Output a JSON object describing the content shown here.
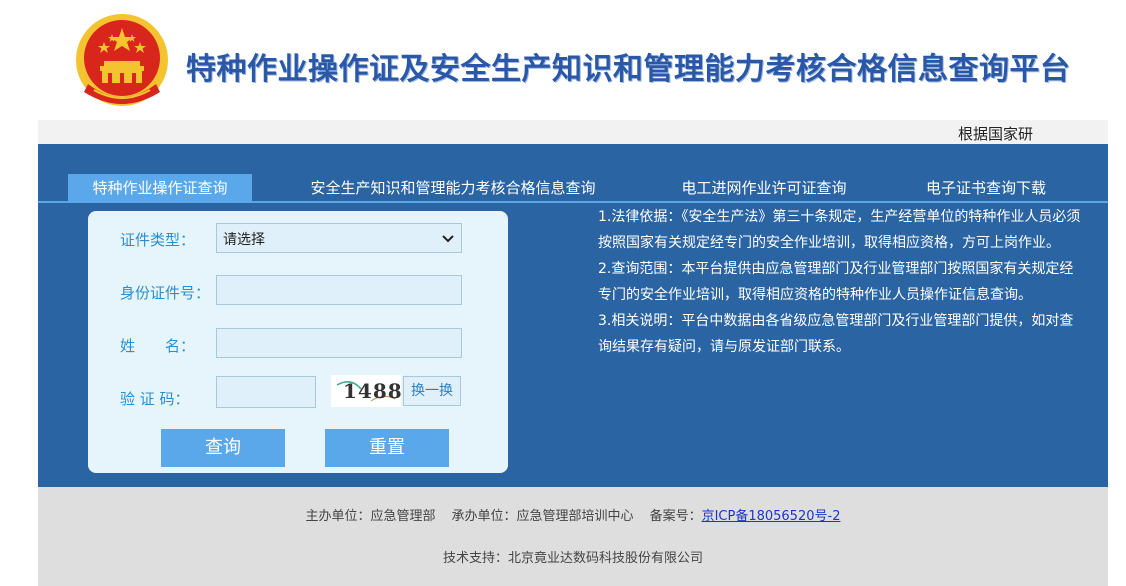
{
  "header": {
    "title": "特种作业操作证及安全生产知识和管理能力考核合格信息查询平台"
  },
  "marquee": {
    "text": "根据国家研"
  },
  "tabs": [
    {
      "label": "特种作业操作证查询",
      "active": true
    },
    {
      "label": "安全生产知识和管理能力考核合格信息查询",
      "active": false
    },
    {
      "label": "电工进网作业许可证查询",
      "active": false
    },
    {
      "label": "电子证书查询下载",
      "active": false
    }
  ],
  "form": {
    "cert_type_label": "证件类型：",
    "cert_type_value": "请选择",
    "id_number_label": "身份证件号：",
    "id_number_value": "",
    "name_label": "姓　　名：",
    "name_value": "",
    "captcha_label": "验 证 码：",
    "captcha_value": "",
    "captcha_image_text": "1488",
    "refresh_label": "换一换",
    "query_label": "查询",
    "reset_label": "重置"
  },
  "info": [
    "1.法律依据：《安全生产法》第三十条规定，生产经营单位的特种作业人员必须按照国家有关规定经专门的安全作业培训，取得相应资格，方可上岗作业。",
    "2.查询范围：本平台提供由应急管理部门及行业管理部门按照国家有关规定经专门的安全作业培训，取得相应资格的特种作业人员操作证信息查询。",
    "3.相关说明：平台中数据由各省级应急管理部门及行业管理部门提供，如对查询结果存有疑问，请与原发证部门联系。"
  ],
  "footer": {
    "host_label": "主办单位：应急管理部",
    "organizer_label": "承办单位：应急管理部培训中心",
    "icp_label": "备案号：",
    "icp_link": "京ICP备18056520号-2",
    "tech_support": "技术支持：北京竟业达数码科技股份有限公司"
  },
  "colors": {
    "primary_blue": "#2b64a3",
    "tab_active": "#5aa8ea",
    "title_blue": "#2a57a6",
    "label_blue": "#2a8fd2",
    "emblem_red": "#d8261c",
    "emblem_gold": "#f4c430"
  },
  "icons": [
    "national-emblem-icon",
    "chevron-down-icon"
  ]
}
